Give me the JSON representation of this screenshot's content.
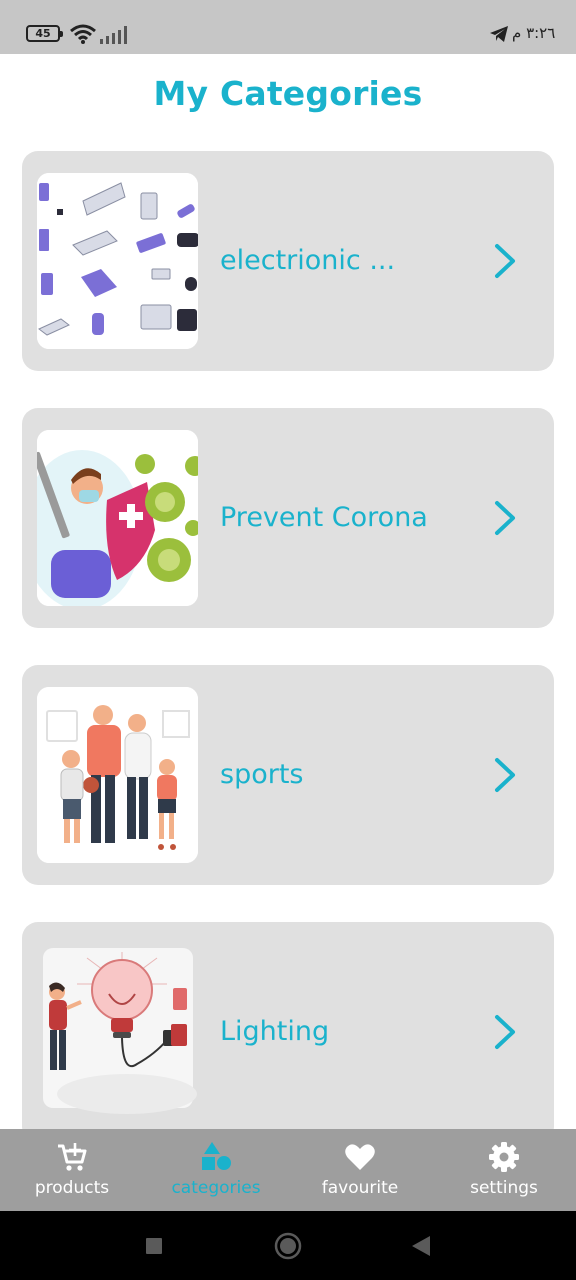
{
  "status_bar": {
    "battery": "45",
    "time": "٣:٢٦ م"
  },
  "page": {
    "title": "My Categories"
  },
  "categories": [
    {
      "label": "electrionic ...",
      "image": "electronics-illustration"
    },
    {
      "label": "Prevent Corona",
      "image": "corona-prevention-illustration"
    },
    {
      "label": "sports",
      "image": "family-sports-illustration"
    },
    {
      "label": "Lighting",
      "image": "lightbulb-illustration"
    }
  ],
  "bottom_nav": {
    "items": [
      {
        "label": "products",
        "icon": "cart-icon",
        "active": false
      },
      {
        "label": "categories",
        "icon": "shapes-icon",
        "active": true
      },
      {
        "label": "favourite",
        "icon": "heart-icon",
        "active": false
      },
      {
        "label": "settings",
        "icon": "gear-icon",
        "active": false
      }
    ]
  },
  "colors": {
    "accent": "#1ab2cc",
    "card": "#e0e0e0",
    "nav_bg": "#9e9e9e",
    "status_bg": "#c6c6c6"
  }
}
